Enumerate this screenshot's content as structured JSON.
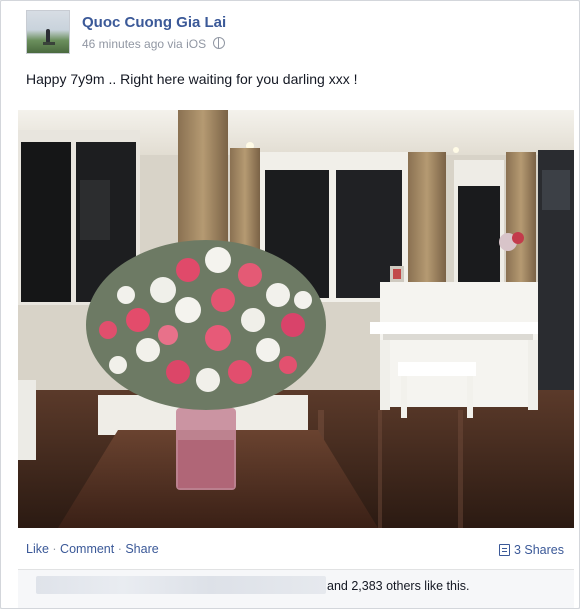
{
  "post": {
    "author": "Quoc Cuong Gia Lai",
    "meta": "46 minutes ago via iOS",
    "text": "Happy 7y9m .. Right here waiting for you darling xxx !"
  },
  "actions": {
    "like": "Like",
    "sep1": " · ",
    "comment": "Comment",
    "sep2": " · ",
    "share": "Share"
  },
  "shares": {
    "label": "3 Shares"
  },
  "likes": {
    "others_text": "and 2,383 others like this."
  },
  "icons": {
    "privacy": "globe-icon",
    "shares": "share-icon"
  },
  "colors": {
    "link": "#3b5998",
    "meta": "#9197a3"
  }
}
